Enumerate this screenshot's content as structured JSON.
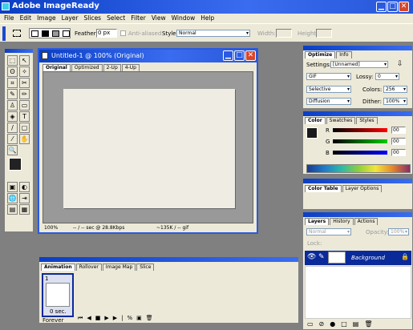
{
  "app": {
    "title": "Adobe ImageReady"
  },
  "menu": [
    "File",
    "Edit",
    "Image",
    "Layer",
    "Slices",
    "Select",
    "Filter",
    "View",
    "Window",
    "Help"
  ],
  "options": {
    "feather_label": "Feather:",
    "feather_value": "0 px",
    "antialiased": "Anti-aliased",
    "style_label": "Style:",
    "style_value": "Normal",
    "width_label": "Width:",
    "height_label": "Height:"
  },
  "document": {
    "title": "Untitled-1 @ 100% (Original)",
    "tabs": [
      "Original",
      "Optimized",
      "2-Up",
      "4-Up"
    ],
    "status": {
      "zoom": "100%",
      "time": "-- / -- sec @ 28.8Kbps",
      "size": "~135K / -- gif"
    }
  },
  "optimize": {
    "tabs": [
      "Optimize",
      "Info"
    ],
    "settings_label": "Settings:",
    "settings_value": "[Unnamed]",
    "format": "GIF",
    "lossy_label": "Lossy:",
    "lossy_value": "0",
    "reduction": "Selective",
    "colors_label": "Colors:",
    "colors_value": "256",
    "dither_algo": "Diffusion",
    "dither_label": "Dither:",
    "dither_value": "100%"
  },
  "color": {
    "tabs": [
      "Color",
      "Swatches",
      "Styles"
    ],
    "channels": [
      {
        "label": "R",
        "value": "00"
      },
      {
        "label": "G",
        "value": "00"
      },
      {
        "label": "B",
        "value": "00"
      }
    ]
  },
  "colortable": {
    "tabs": [
      "Color Table",
      "Layer Options"
    ]
  },
  "layers": {
    "tabs": [
      "Layers",
      "History",
      "Actions"
    ],
    "blend": "Normal",
    "opacity_label": "Opacity:",
    "opacity_value": "100%",
    "lock_label": "Lock:",
    "layer_name": "Background"
  },
  "animation": {
    "tabs": [
      "Animation",
      "Rollover",
      "Image Map",
      "Slice"
    ],
    "frame_number": "1",
    "frame_delay": "0 sec.",
    "loop": "Forever"
  }
}
